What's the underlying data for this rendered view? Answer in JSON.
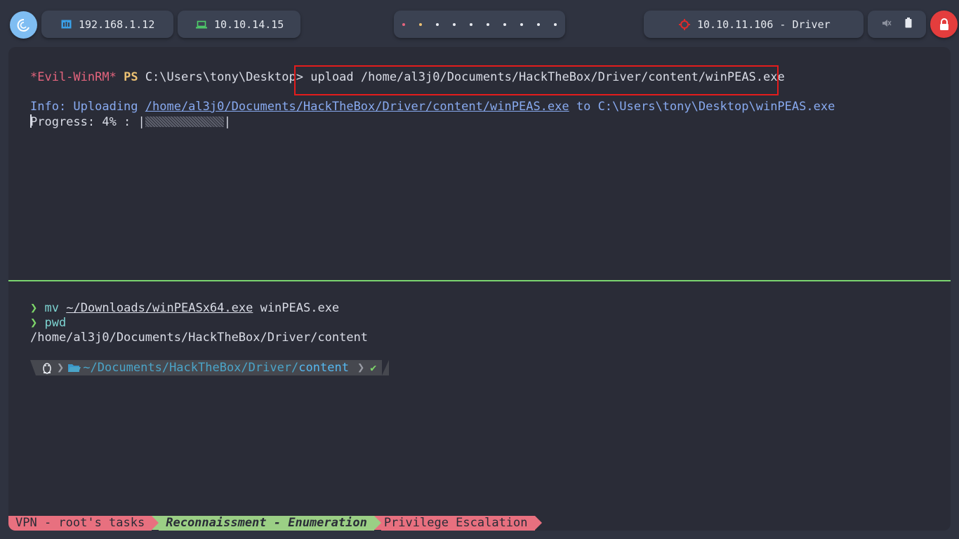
{
  "topbar": {
    "host_ip": "192.168.1.12",
    "vpn_ip": "10.10.14.15",
    "target": "10.10.11.106 - Driver",
    "workspaces": [
      "#e4647d",
      "#ecc173",
      "#e6e9ef",
      "#e6e9ef",
      "#e6e9ef",
      "#e6e9ef",
      "#e6e9ef",
      "#e6e9ef",
      "#e6e9ef",
      "#e6e9ef"
    ],
    "icons": {
      "distro": "debian-swirl-icon",
      "host": "ethernet-icon",
      "vpn": "laptop-icon",
      "target": "crosshair-icon",
      "mute": "speaker-muted-icon",
      "battery": "battery-icon",
      "lock": "lock-icon"
    }
  },
  "terminal_top": {
    "prompt_name": "*Evil-WinRM*",
    "prompt_ps": "PS",
    "prompt_path": "C:\\Users\\tony\\Desktop>",
    "command": "upload /home/al3j0/Documents/HackTheBox/Driver/content/winPEAS.exe",
    "info_prefix": "Info: Uploading ",
    "info_src": "/home/al3j0/Documents/HackTheBox/Driver/content/winPEAS.exe",
    "info_suffix": " to C:\\Users\\tony\\Desktop\\winPEAS.exe",
    "progress_label": "Progress: 4% : |",
    "progress_end": "|",
    "progress_percent": 4
  },
  "terminal_bottom": {
    "prompt_char": "❯",
    "cmd1_name": "mv",
    "cmd1_arg1": "~/Downloads/winPEASx64.exe",
    "cmd1_arg2": " winPEAS.exe",
    "cmd2_name": "pwd",
    "output": "/home/al3j0/Documents/HackTheBox/Driver/content",
    "ps_dir_prefix": "~/Documents/HackTheBox/Driver/",
    "ps_dir_current": "content",
    "ps_ok": "✔"
  },
  "statusbar": {
    "tab1": "VPN - root's tasks",
    "tab2": "Reconnaissment - Enumeration",
    "tab3": "Privilege Escalation"
  },
  "colors": {
    "accent_green": "#7bd56f",
    "highlight_red": "#e31c1c",
    "lock_red": "#e43d3d"
  }
}
